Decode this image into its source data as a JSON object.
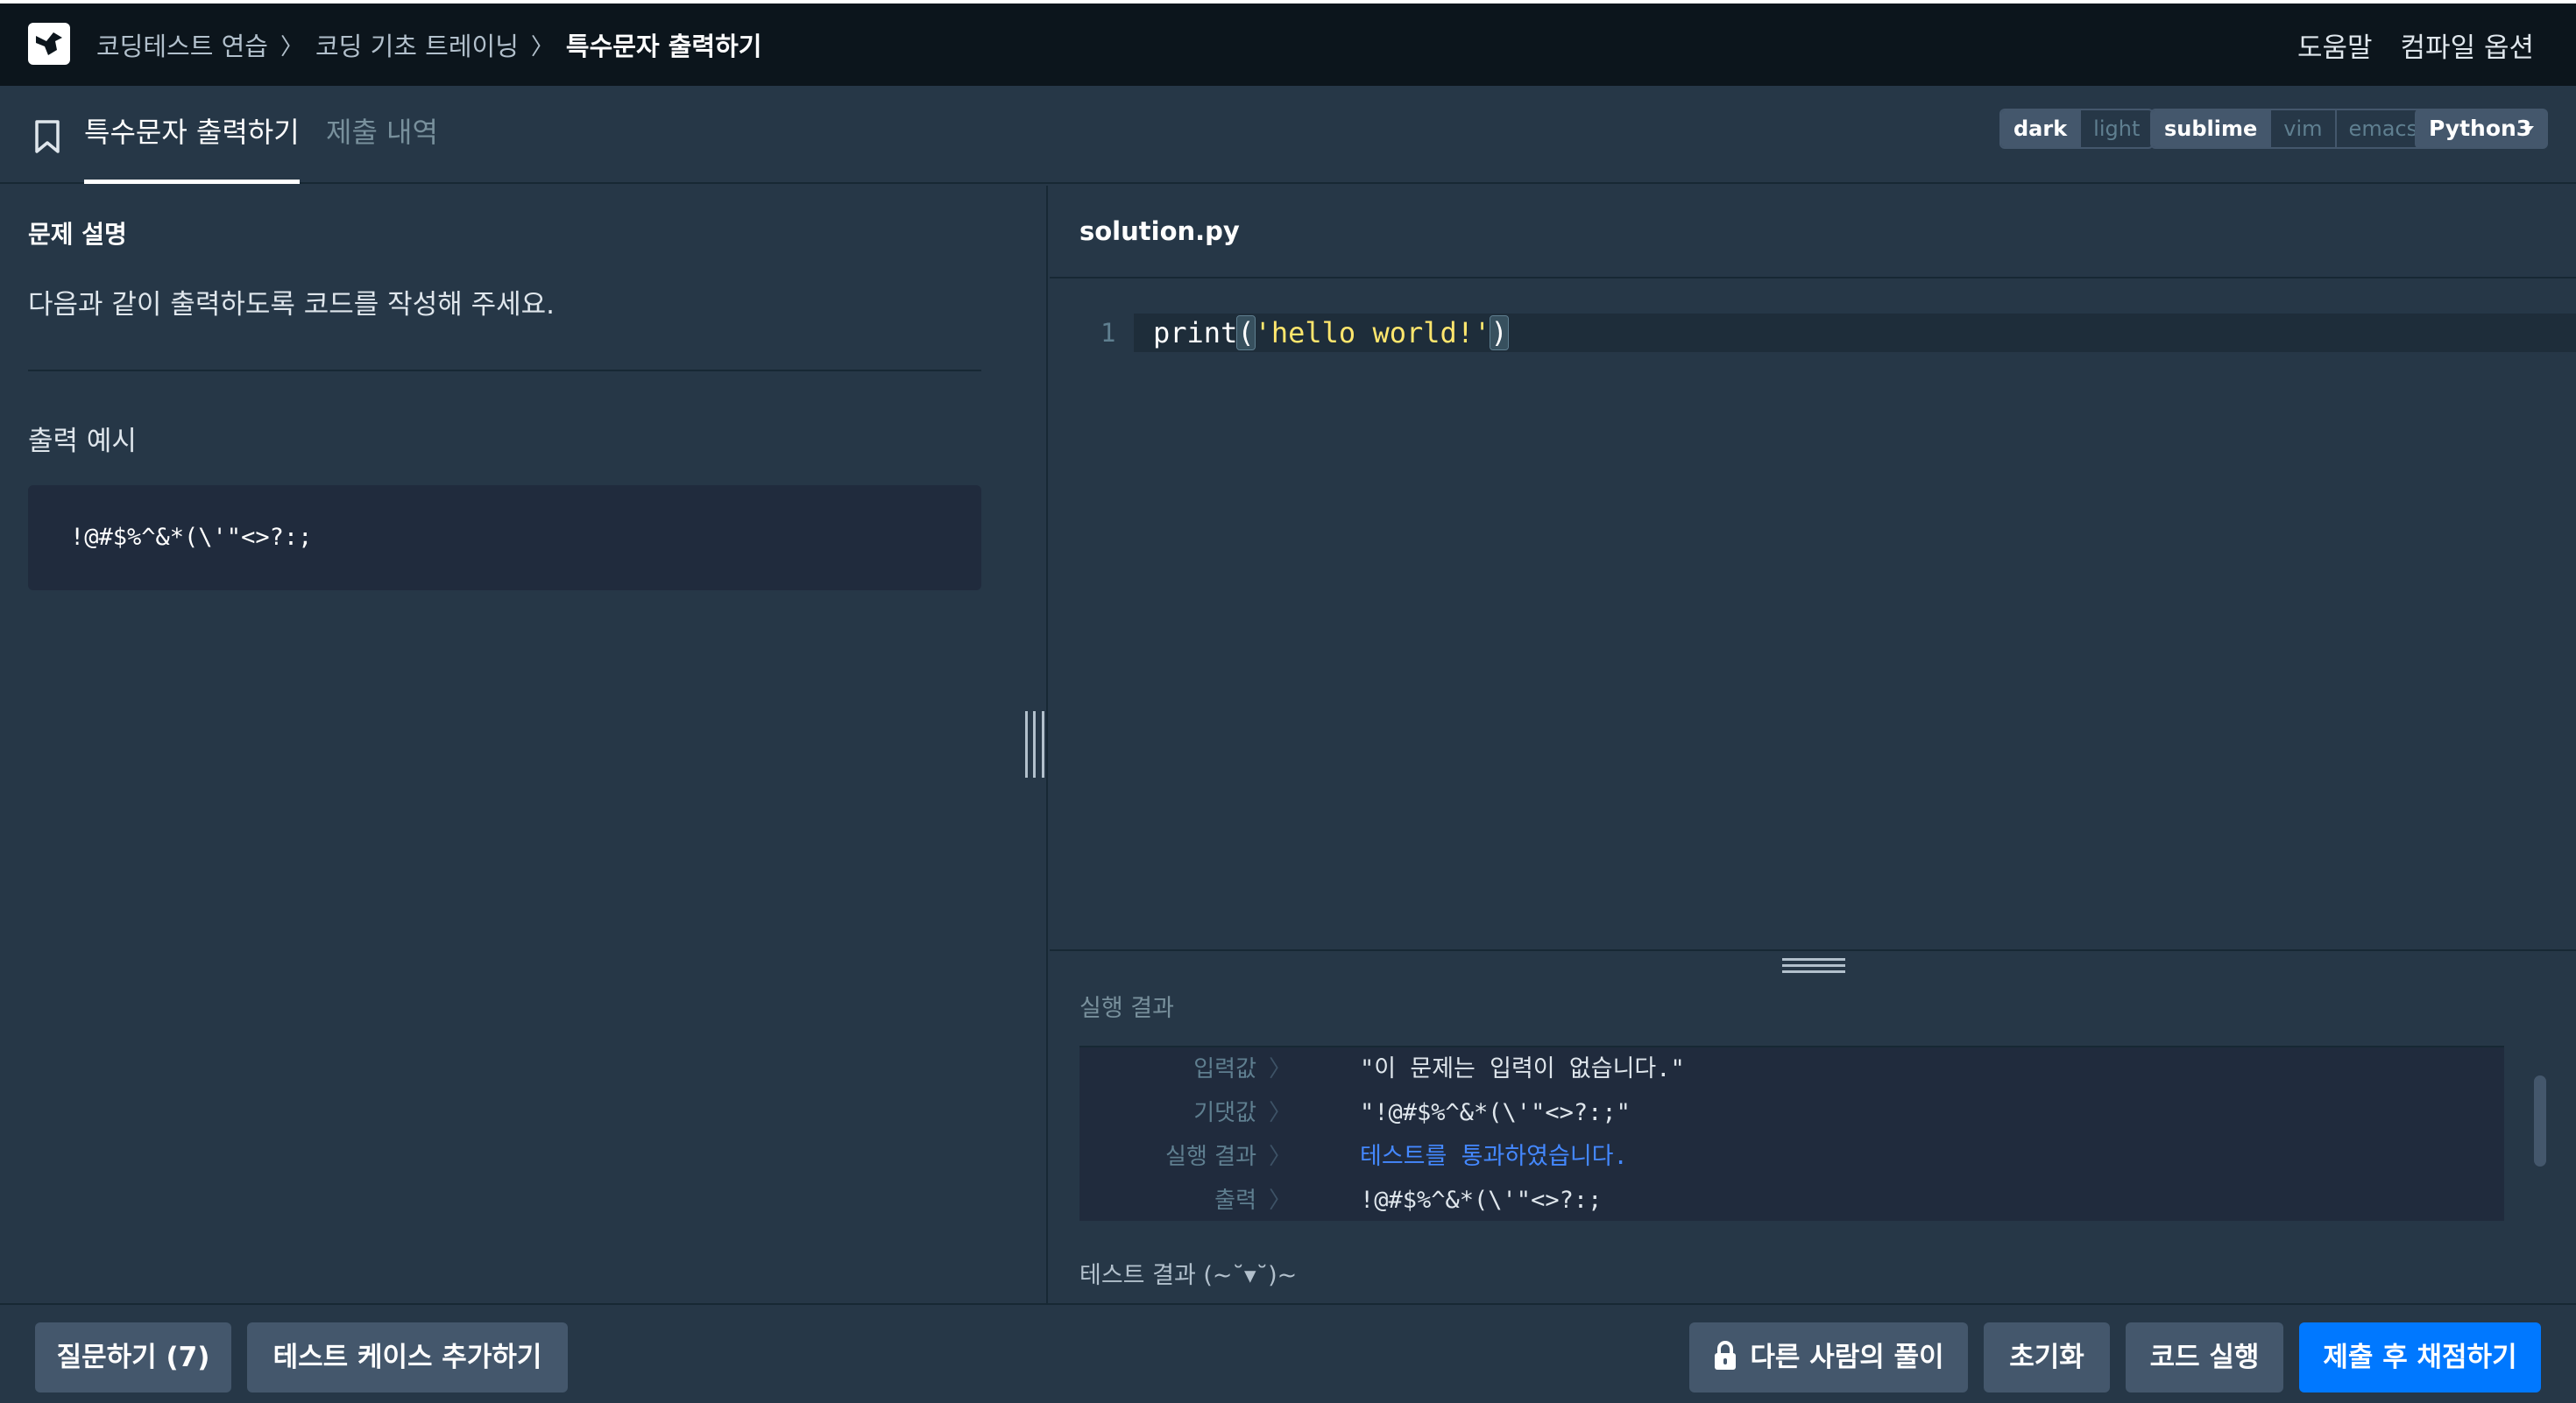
{
  "breadcrumb": {
    "items": [
      "코딩테스트 연습",
      "코딩 기초 트레이닝"
    ],
    "current": "특수문자 출력하기",
    "separator": "〉"
  },
  "topbar": {
    "help": "도움말",
    "compile_options": "컴파일 옵션"
  },
  "tabs": {
    "problem": "특수문자 출력하기",
    "submissions": "제출 내역"
  },
  "editor_options": {
    "theme": [
      "dark",
      "light"
    ],
    "theme_selected": "dark",
    "keymap": [
      "sublime",
      "vim",
      "emacs"
    ],
    "keymap_selected": "sublime",
    "language": "Python3"
  },
  "problem": {
    "section_title": "문제 설명",
    "description": "다음과 같이 출력하도록 코드를 작성해 주세요.",
    "example_title": "출력 예시",
    "example_output": "!@#$%^&*(\\'\"<>?:;"
  },
  "editor": {
    "filename": "solution.py",
    "line_number": "1",
    "code_prefix": "print",
    "code_open": "(",
    "code_string": "'hello world!'",
    "code_close": ")"
  },
  "result": {
    "title": "실행 결과",
    "rows": [
      {
        "label": "입력값",
        "value": "\"이 문제는 입력이 없습니다.\""
      },
      {
        "label": "기댓값",
        "value": "\"!@#$%^&*(\\'\"<>?:;\""
      },
      {
        "label": "실행 결과",
        "value": "테스트를 통과하였습니다."
      },
      {
        "label": "출력",
        "value": "!@#$%^&*(\\'\"<>?:;"
      }
    ],
    "arrow": "〉",
    "summary": "테스트 결과 (~˘▾˘)~"
  },
  "buttons": {
    "ask": "질문하기 (7)",
    "add_test_case": "테스트 케이스 추가하기",
    "others_solutions": "다른 사람의 풀이",
    "reset": "초기화",
    "run": "코드 실행",
    "submit": "제출 후 채점하기"
  },
  "colors": {
    "background": "#263747",
    "topbar": "#0c151c",
    "primary": "#0078ff",
    "pass": "#4488ff",
    "code_string": "#ffe66d"
  }
}
